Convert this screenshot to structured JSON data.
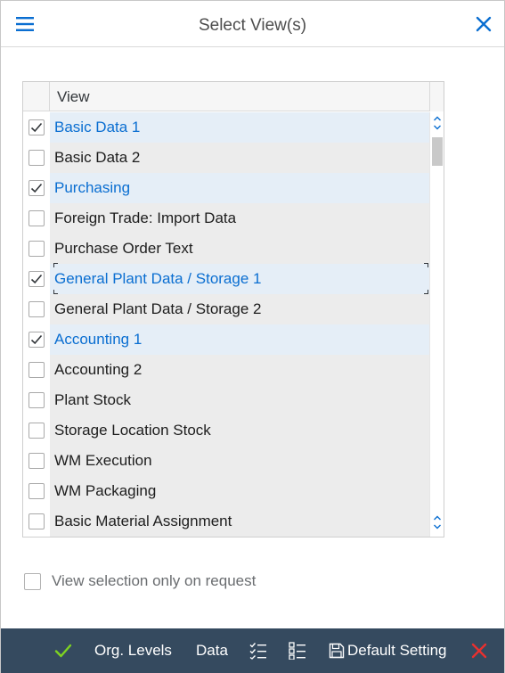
{
  "dialog": {
    "title": "Select View(s)"
  },
  "table": {
    "column_header": "View",
    "rows": [
      {
        "label": "Basic Data 1",
        "checked": true
      },
      {
        "label": "Basic Data 2",
        "checked": false
      },
      {
        "label": "Purchasing",
        "checked": true
      },
      {
        "label": "Foreign Trade: Import Data",
        "checked": false
      },
      {
        "label": "Purchase Order Text",
        "checked": false
      },
      {
        "label": "General Plant Data / Storage 1",
        "checked": true,
        "focused": true
      },
      {
        "label": "General Plant Data / Storage 2",
        "checked": false
      },
      {
        "label": "Accounting 1",
        "checked": true
      },
      {
        "label": "Accounting 2",
        "checked": false
      },
      {
        "label": "Plant Stock",
        "checked": false
      },
      {
        "label": "Storage Location Stock",
        "checked": false
      },
      {
        "label": "WM Execution",
        "checked": false
      },
      {
        "label": "WM Packaging",
        "checked": false
      },
      {
        "label": "Basic Material Assignment",
        "checked": false
      }
    ]
  },
  "option": {
    "label": "View selection only on request",
    "checked": false
  },
  "footer": {
    "org_levels_label": "Org. Levels",
    "data_label": "Data",
    "default_setting_label": "Default Setting"
  },
  "colors": {
    "accent": "#0a6ed1",
    "footer_bg": "#354a5f",
    "confirm_green": "#7ed321",
    "cancel_red": "#e9302f",
    "selected_row_bg": "#e5eef7",
    "row_bg": "#ececec"
  },
  "icons": {
    "menu": "hamburger-menu-icon",
    "close": "close-icon",
    "confirm": "checkmark-icon",
    "select_all": "select-all-icon",
    "deselect_all": "deselect-all-icon",
    "save": "save-icon",
    "cancel": "cancel-icon"
  }
}
